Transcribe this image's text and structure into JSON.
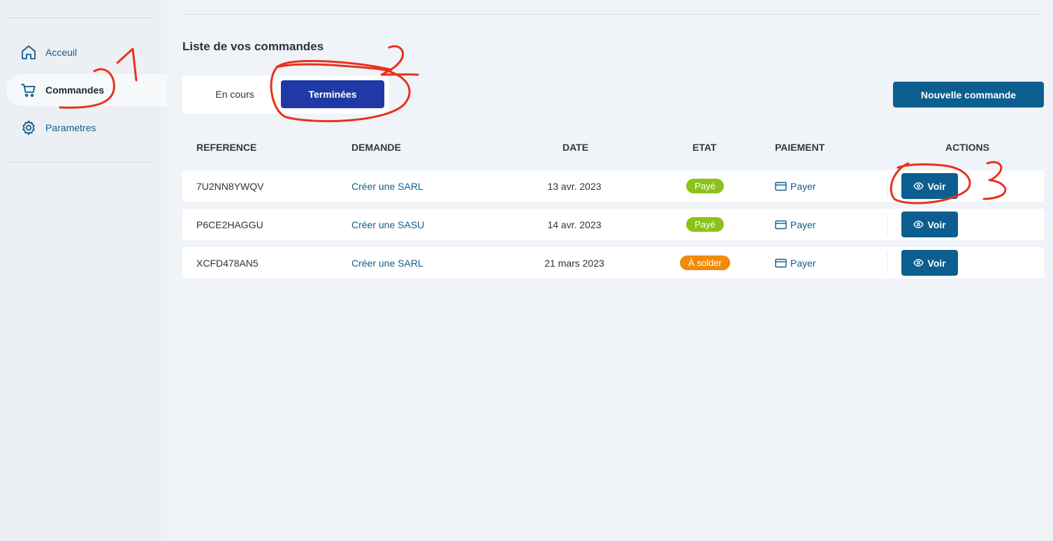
{
  "sidebar": {
    "items": [
      {
        "label": "Acceuil",
        "icon": "home-icon"
      },
      {
        "label": "Commandes",
        "icon": "cart-icon",
        "active": true
      },
      {
        "label": "Parametres",
        "icon": "gear-icon"
      }
    ]
  },
  "main": {
    "title": "Liste de vos commandes",
    "tabs": [
      {
        "label": "En cours"
      },
      {
        "label": "Terminées",
        "active": true
      }
    ],
    "new_order_label": "Nouvelle commande",
    "columns": [
      "REFERENCE",
      "DEMANDE",
      "DATE",
      "ETAT",
      "PAIEMENT",
      "ACTIONS"
    ],
    "rows": [
      {
        "reference": "7U2NN8YWQV",
        "demande": "Créer une SARL",
        "date": "13 avr. 2023",
        "etat": "Payé",
        "etat_color": "#8cc21a",
        "paiement": "Payer",
        "action": "Voir"
      },
      {
        "reference": "P6CE2HAGGU",
        "demande": "Créer une SASU",
        "date": "14 avr. 2023",
        "etat": "Payé",
        "etat_color": "#8cc21a",
        "paiement": "Payer",
        "action": "Voir"
      },
      {
        "reference": "XCFD478AN5",
        "demande": "Créer une SARL",
        "date": "21 mars 2023",
        "etat": "À solder",
        "etat_color": "#f28a0c",
        "paiement": "Payer",
        "action": "Voir"
      }
    ]
  },
  "annotations": [
    "1",
    "2",
    "3"
  ],
  "colors": {
    "accent": "#0c5e8e",
    "active_tab": "#1f3aa6",
    "annotation": "#e8321c",
    "paid": "#8cc21a",
    "to_settle": "#f28a0c"
  }
}
